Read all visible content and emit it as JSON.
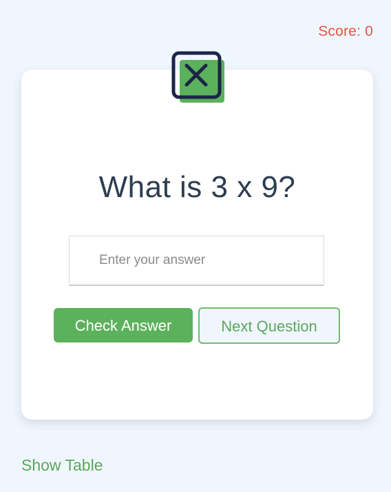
{
  "score": {
    "label": "Score: 0"
  },
  "logo": {
    "icon": "x-square-icon",
    "colors": {
      "outline": "#1c2547",
      "fill": "#5cb15c"
    }
  },
  "question": {
    "text": "What is 3 x 9?"
  },
  "answer": {
    "placeholder": "Enter your answer",
    "value": ""
  },
  "buttons": {
    "check_label": "Check Answer",
    "next_label": "Next Question"
  },
  "footer": {
    "show_table_label": "Show Table"
  },
  "colors": {
    "background": "#f0f6fd",
    "score": "#e2553f",
    "accent": "#5cb15c",
    "question_text": "#2c3e50"
  }
}
